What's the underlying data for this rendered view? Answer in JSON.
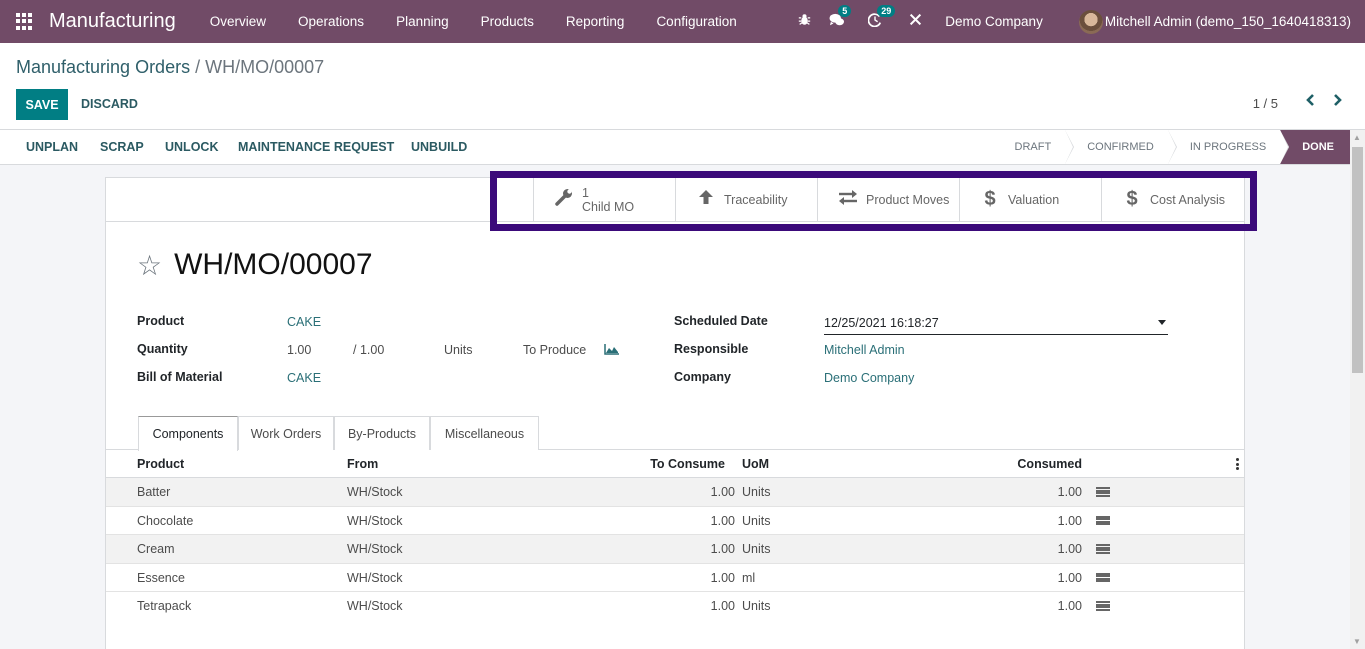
{
  "navbar": {
    "app_name": "Manufacturing",
    "menu": [
      "Overview",
      "Operations",
      "Planning",
      "Products",
      "Reporting",
      "Configuration"
    ],
    "messages_badge": "5",
    "activities_badge": "29",
    "company": "Demo Company",
    "user": "Mitchell Admin (demo_150_1640418313)"
  },
  "breadcrumb": {
    "parent": "Manufacturing Orders",
    "separator": "/",
    "current": "WH/MO/00007"
  },
  "toolbar": {
    "save_label": "SAVE",
    "discard_label": "DISCARD",
    "pager": "1 / 5",
    "prev_icon": "chevron-left",
    "next_icon": "chevron-right"
  },
  "actions": [
    "UNPLAN",
    "SCRAP",
    "UNLOCK",
    "MAINTENANCE REQUEST",
    "UNBUILD"
  ],
  "stages": [
    {
      "label": "DRAFT",
      "active": false
    },
    {
      "label": "CONFIRMED",
      "active": false
    },
    {
      "label": "IN PROGRESS",
      "active": false
    },
    {
      "label": "DONE",
      "active": true
    }
  ],
  "smart_buttons": [
    {
      "icon": "wrench",
      "count": "1",
      "label": "Child MO"
    },
    {
      "icon": "arrow-up",
      "label": "Traceability"
    },
    {
      "icon": "exchange",
      "label": "Product Moves"
    },
    {
      "icon": "dollar",
      "label": "Valuation"
    },
    {
      "icon": "dollar",
      "label": "Cost Analysis"
    }
  ],
  "record": {
    "title": "WH/MO/00007",
    "favorite": false
  },
  "fields": {
    "product_label": "Product",
    "product_value": "CAKE",
    "quantity_label": "Quantity",
    "quantity_produced": "1.00",
    "quantity_total": "/ 1.00",
    "quantity_uom": "Units",
    "to_produce_label": "To Produce",
    "bom_label": "Bill of Material",
    "bom_value": "CAKE",
    "scheduled_date_label": "Scheduled Date",
    "scheduled_date_value": "12/25/2021 16:18:27",
    "responsible_label": "Responsible",
    "responsible_value": "Mitchell Admin",
    "company_label": "Company",
    "company_value": "Demo Company"
  },
  "tabs": [
    {
      "label": "Components",
      "active": true
    },
    {
      "label": "Work Orders",
      "active": false
    },
    {
      "label": "By-Products",
      "active": false
    },
    {
      "label": "Miscellaneous",
      "active": false
    }
  ],
  "components_table": {
    "headers": {
      "product": "Product",
      "from": "From",
      "to_consume": "To Consume",
      "uom": "UoM",
      "consumed": "Consumed"
    },
    "rows": [
      {
        "product": "Batter",
        "from": "WH/Stock",
        "to_consume": "1.00",
        "uom": "Units",
        "consumed": "1.00"
      },
      {
        "product": "Chocolate",
        "from": "WH/Stock",
        "to_consume": "1.00",
        "uom": "Units",
        "consumed": "1.00"
      },
      {
        "product": "Cream",
        "from": "WH/Stock",
        "to_consume": "1.00",
        "uom": "Units",
        "consumed": "1.00"
      },
      {
        "product": "Essence",
        "from": "WH/Stock",
        "to_consume": "1.00",
        "uom": "ml",
        "consumed": "1.00"
      },
      {
        "product": "Tetrapack",
        "from": "WH/Stock",
        "to_consume": "1.00",
        "uom": "Units",
        "consumed": "1.00"
      }
    ]
  },
  "colors": {
    "brand": "#714b67",
    "primary": "#017e84",
    "highlight_box": "#3b0a7a"
  }
}
